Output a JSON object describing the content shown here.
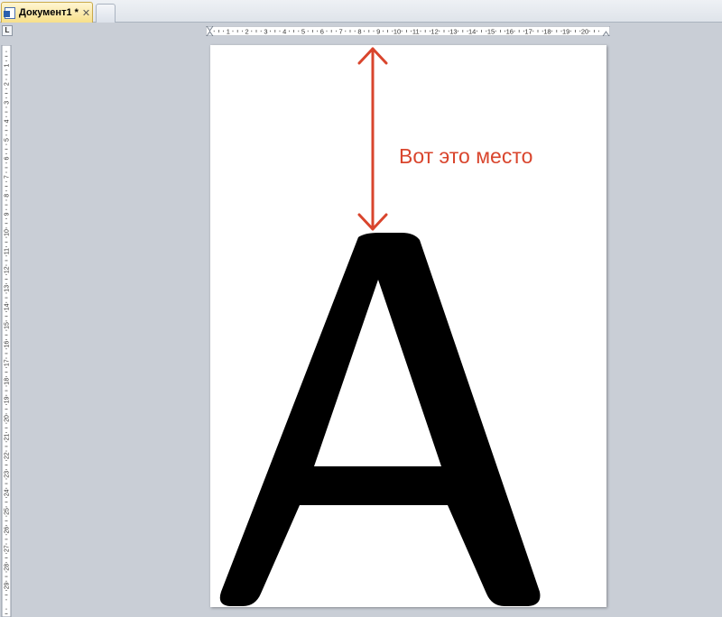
{
  "window": {
    "tab_title": "Документ1 *",
    "close_glyph": "✕"
  },
  "ruler": {
    "corner_label": "L",
    "horizontal_ticks": [
      "1",
      "2",
      "3",
      "4",
      "5",
      "6",
      "7",
      "8",
      "9",
      "10",
      "11",
      "12",
      "13",
      "14",
      "15",
      "16",
      "17",
      "18",
      "19",
      "20"
    ],
    "vertical_ticks": [
      "1",
      "2",
      "3",
      "4",
      "5",
      "6",
      "7",
      "8",
      "9",
      "10",
      "11",
      "12",
      "13",
      "14",
      "15",
      "16",
      "17",
      "18",
      "19",
      "20",
      "21",
      "22",
      "23",
      "24",
      "25",
      "26",
      "27",
      "28",
      "29"
    ]
  },
  "document": {
    "annotation": "Вот это место",
    "big_letter": "A"
  },
  "colors": {
    "annotation": "#d9452d",
    "arrow": "#d9452d",
    "letter": "#000000",
    "tab_active": "#f7e08a"
  },
  "icons": {
    "doc": "word-document-icon",
    "close": "close-icon"
  }
}
